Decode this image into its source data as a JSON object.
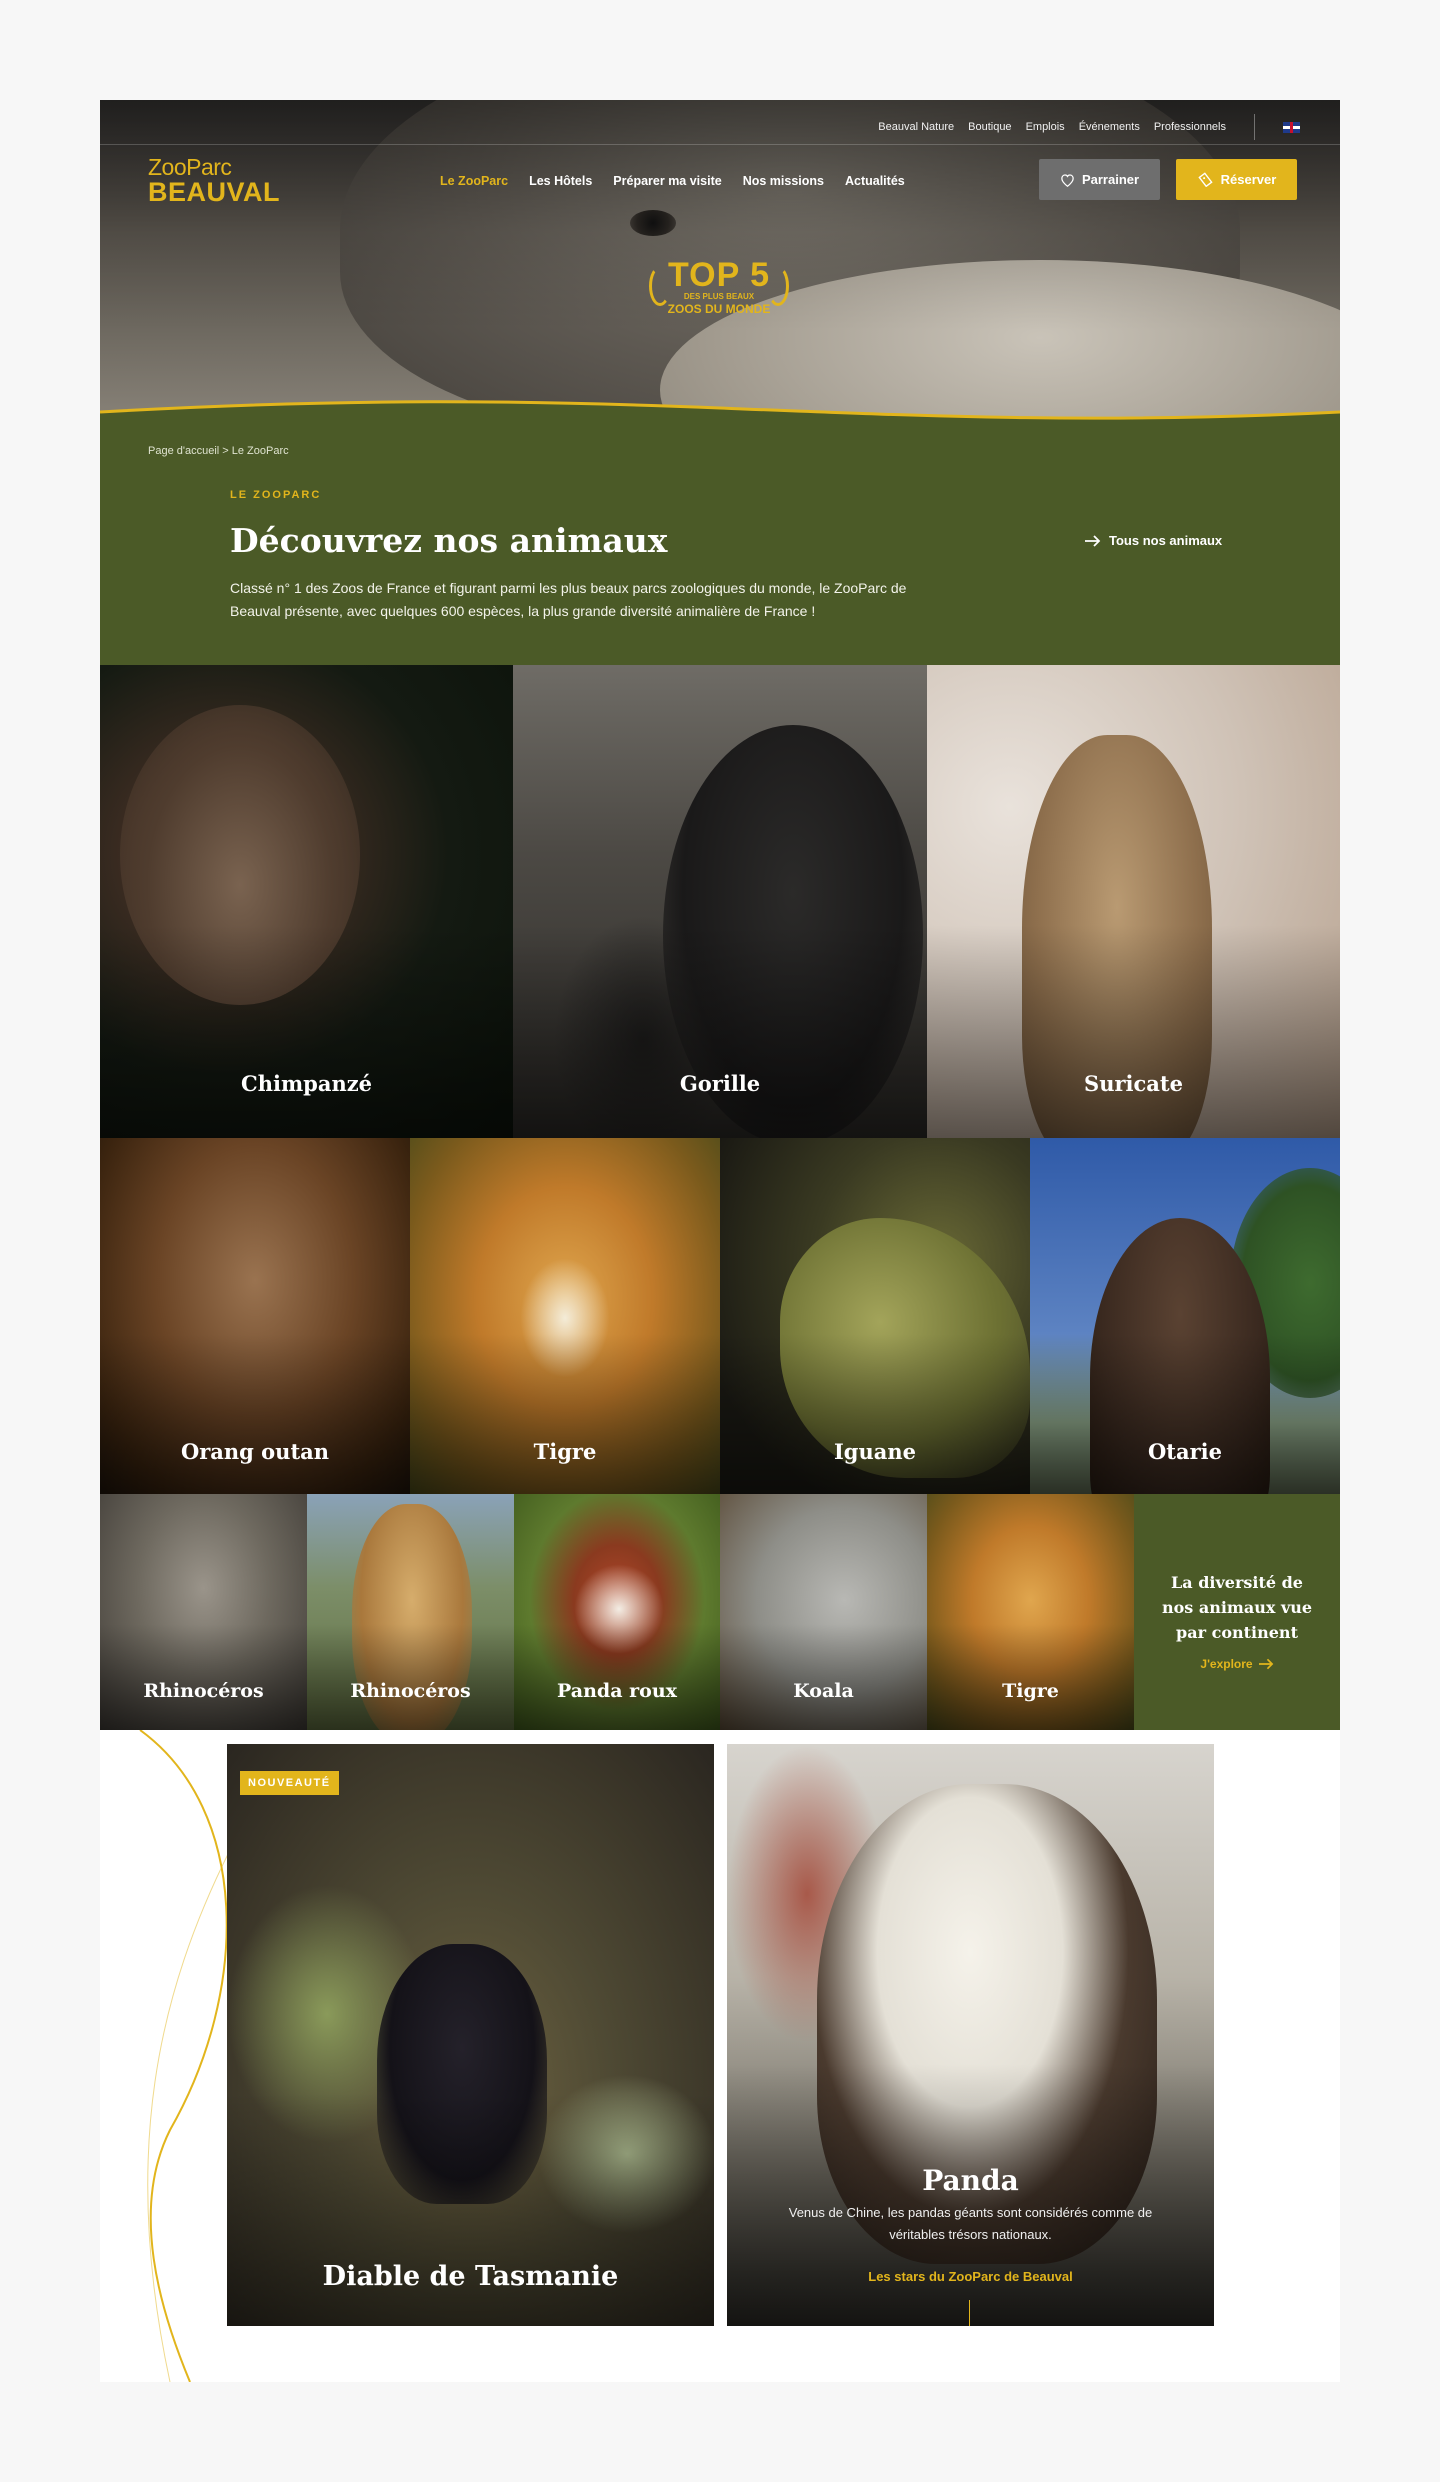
{
  "topnav": {
    "links": [
      "Beauval Nature",
      "Boutique",
      "Emplois",
      "Événements",
      "Professionnels"
    ],
    "language_icon": "uk-flag-icon"
  },
  "logo": {
    "line1": "ZooParc",
    "line2": "BEAUVAL"
  },
  "mainnav": {
    "items": [
      "Le ZooParc",
      "Les Hôtels",
      "Préparer ma visite",
      "Nos missions",
      "Actualités"
    ],
    "active_index": 0
  },
  "actions": {
    "parrainer": "Parrainer",
    "reserver": "Réserver"
  },
  "badge": {
    "top": "TOP 5",
    "sub": "DES PLUS BEAUX",
    "main": "ZOOS DU MONDE"
  },
  "breadcrumb": "Page d'accueil > Le ZooParc",
  "intro": {
    "kicker": "LE ZOOPARC",
    "title": "Découvrez nos animaux",
    "text": "Classé n° 1 des Zoos de France et figurant parmi les plus beaux parcs zoologiques du monde, le ZooParc de Beauval présente, avec quelques 600 espèces, la plus grande diversité animalière de France !",
    "all_link": "Tous nos animaux"
  },
  "animals_row1": [
    "Chimpanzé",
    "Gorille",
    "Suricate"
  ],
  "animals_row2": [
    "Orang outan",
    "Tigre",
    "Iguane",
    "Otarie"
  ],
  "animals_row3": [
    "Rhinocéros",
    "Rhinocéros",
    "Panda roux",
    "Koala",
    "Tigre"
  ],
  "diversity": {
    "text": "La diversité de nos animaux vue par continent",
    "cta": "J'explore"
  },
  "cards": {
    "tasmanie": {
      "tag": "NOUVEAUTÉ",
      "title": "Diable de Tasmanie"
    },
    "panda": {
      "title": "Panda",
      "desc": "Venus de Chine, les pandas géants sont considérés comme de véritables trésors nationaux.",
      "link": "Les stars du ZooParc de Beauval"
    }
  },
  "colors": {
    "brand_green": "#4b5a27",
    "brand_gold": "#e2b51c"
  }
}
